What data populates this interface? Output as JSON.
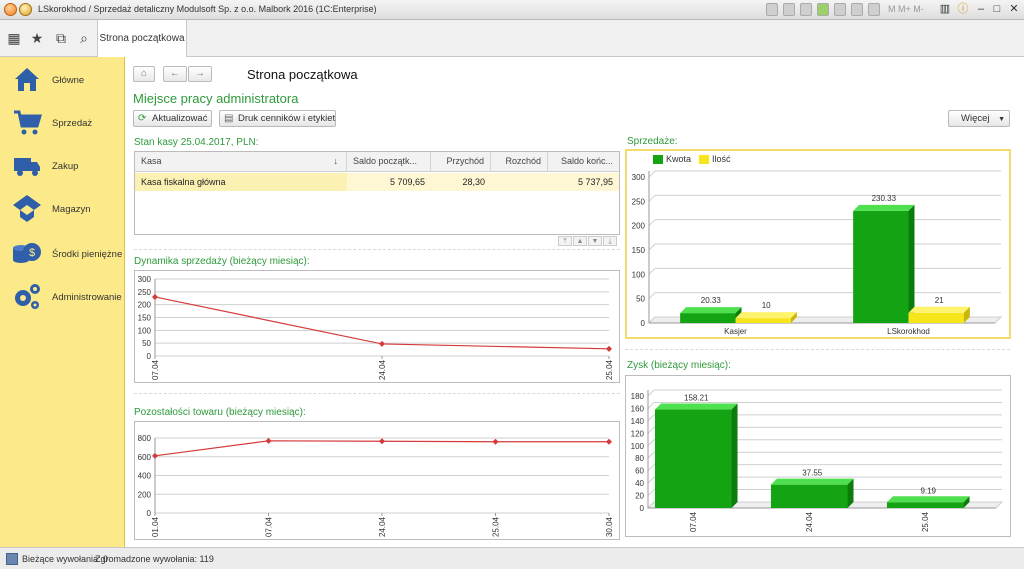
{
  "window": {
    "title": "LSkorokhod / Sprzedaż detaliczny Modulsoft Sp. z o.o. Malbork 2016  (1C:Enterprise)",
    "mem_labels": "M  M+  M-"
  },
  "toolbar": {
    "active_tab": "Strona początkowa"
  },
  "sidebar": {
    "items": [
      {
        "label": "Główne",
        "icon": "home-icon"
      },
      {
        "label": "Sprzedaż",
        "icon": "cart-icon"
      },
      {
        "label": "Zakup",
        "icon": "truck-icon"
      },
      {
        "label": "Magazyn",
        "icon": "boxes-icon"
      },
      {
        "label": "Środki pieniężne",
        "icon": "coins-icon"
      },
      {
        "label": "Administrowanie",
        "icon": "gears-icon"
      }
    ]
  },
  "main": {
    "page_title": "Strona początkowa",
    "subtitle": "Miejsce pracy administratora",
    "refresh_label": "Aktualizować",
    "print_label": "Druk cenników i etykiet",
    "more_label": "Więcej"
  },
  "cash": {
    "label": "Stan kasy 25.04.2017, PLN:",
    "columns": [
      "Kasa",
      "Saldo początk...",
      "Przychód",
      "Rozchód",
      "Saldo końc..."
    ],
    "rows": [
      {
        "kasa": "Kasa fiskalna główna",
        "saldo_pocz": "5 709,65",
        "przychod": "28,30",
        "rozchod": "",
        "saldo_konc": "5 737,95"
      }
    ]
  },
  "sections": {
    "dynamika": "Dynamika sprzedaży (bieżący miesiąc):",
    "pozostalosci": "Pozostałości towaru (bieżący miesiąc):",
    "sprzedaze": "Sprzedaże:",
    "zysk": "Zysk (bieżący miesiąc):"
  },
  "statusbar": {
    "current_calls": "Bieżące wywołania: 0",
    "accumulated_calls": "Zgromadzone wywołania: 119"
  },
  "colors": {
    "green": "#13a313",
    "green_light": "#4fe04f",
    "yellow": "#f5e51a",
    "line_red": "#d43a3a",
    "accent_text": "#2e9a3b",
    "sidebar_bg": "#fcea8a"
  },
  "chart_data": [
    {
      "type": "line",
      "title": "Dynamika sprzedaży (bieżący miesiąc):",
      "x": [
        "07.04",
        "24.04",
        "25.04"
      ],
      "series": [
        {
          "values": [
            230,
            47,
            28
          ]
        }
      ],
      "ylim": [
        0,
        300
      ],
      "yticks": [
        0,
        50,
        100,
        150,
        200,
        250,
        300
      ],
      "grid": true
    },
    {
      "type": "line",
      "title": "Pozostałości towaru (bieżący miesiąc):",
      "x": [
        "01.04",
        "07.04",
        "24.04",
        "25.04",
        "30.04"
      ],
      "series": [
        {
          "values": [
            610,
            770,
            765,
            760,
            760
          ]
        }
      ],
      "ylim": [
        0,
        800
      ],
      "yticks": [
        0,
        200,
        400,
        600,
        800
      ],
      "grid": true
    },
    {
      "type": "bar",
      "title": "Sprzedaże:",
      "categories": [
        "Kasjer",
        "LSkorokhod"
      ],
      "series": [
        {
          "name": "Kwota",
          "values": [
            20.33,
            230.33
          ]
        },
        {
          "name": "Ilość",
          "values": [
            10,
            21
          ]
        }
      ],
      "data_labels": [
        [
          "20.33",
          "230.33"
        ],
        [
          "10",
          "21"
        ]
      ],
      "ylim": [
        0,
        300
      ],
      "yticks": [
        0,
        50,
        100,
        150,
        200,
        250,
        300
      ],
      "legend": "top-left",
      "grid": true
    },
    {
      "type": "bar",
      "title": "Zysk (bieżący miesiąc):",
      "categories": [
        "07.04",
        "24.04",
        "25.04"
      ],
      "values": [
        158.21,
        37.55,
        9.19
      ],
      "data_labels": [
        "158.21",
        "37.55",
        "9.19"
      ],
      "ylim": [
        0,
        180
      ],
      "yticks": [
        0,
        20,
        40,
        60,
        80,
        100,
        120,
        140,
        160,
        180
      ],
      "grid": true
    }
  ]
}
